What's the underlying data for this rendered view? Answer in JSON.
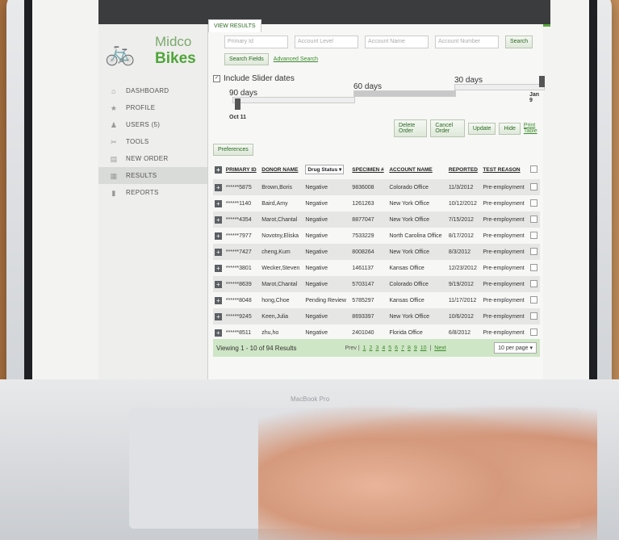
{
  "app": {
    "brand_top": "Midco",
    "brand_bottom": "Bikes"
  },
  "tabs": [
    {
      "label": "VIEW RESULTS"
    }
  ],
  "search": {
    "primary_id_placeholder": "Primary Id",
    "account_level_placeholder": "Account Level",
    "account_name_placeholder": "Account Name",
    "account_number_placeholder": "Account Number",
    "search_label": "Search",
    "search_fields_label": "Search Fields",
    "advanced_search_label": "Advanced Search"
  },
  "sidebar": {
    "items": [
      {
        "label": "DASHBOARD",
        "icon": "house-icon"
      },
      {
        "label": "PROFILE",
        "icon": "star-icon"
      },
      {
        "label": "USERS (5)",
        "icon": "users-icon"
      },
      {
        "label": "TOOLS",
        "icon": "tools-icon"
      },
      {
        "label": "NEW ORDER",
        "icon": "order-icon"
      },
      {
        "label": "RESULTS",
        "icon": "results-icon",
        "active": true
      },
      {
        "label": "REPORTS",
        "icon": "chart-icon"
      }
    ]
  },
  "slider": {
    "include_label": "Include Slider dates",
    "label_90": "90 days",
    "label_60": "60 days",
    "label_30": "30 days",
    "start_date": "Oct 11",
    "end_date": "Jan 9"
  },
  "actions": {
    "delete": "Delete Order",
    "cancel": "Cancel Order",
    "update": "Update",
    "hide": "Hide",
    "print": "Print Table",
    "preferences": "Preferences"
  },
  "table": {
    "headers": [
      "PRIMARY ID",
      "DONOR NAME",
      "Drug Status",
      "SPECIMEN #",
      "ACCOUNT NAME",
      "REPORTED",
      "TEST REASON"
    ],
    "rows": [
      [
        "******5875",
        "Brown,Boris",
        "Negative",
        "9836008",
        "Colorado Office",
        "11/3/2012",
        "Pre-employment"
      ],
      [
        "******1140",
        "Baird,Amy",
        "Negative",
        "1261263",
        "New York Office",
        "10/12/2012",
        "Pre-employment"
      ],
      [
        "******4354",
        "Marot,Chantal",
        "Negative",
        "8877047",
        "New York Office",
        "7/15/2012",
        "Pre-employment"
      ],
      [
        "******7977",
        "Novotny,Eliska",
        "Negative",
        "7533229",
        "North Carolina Office",
        "8/17/2012",
        "Pre-employment"
      ],
      [
        "******7427",
        "cheng,Kum",
        "Negative",
        "8008264",
        "New York Office",
        "8/3/2012",
        "Pre-employment"
      ],
      [
        "******3801",
        "Wecker,Steven",
        "Negative",
        "1461137",
        "Kansas Office",
        "12/23/2012",
        "Pre-employment"
      ],
      [
        "******8639",
        "Marot,Chantal",
        "Negative",
        "5703147",
        "Colorado Office",
        "9/19/2012",
        "Pre-employment"
      ],
      [
        "******8048",
        "hong,Choe",
        "Pending Review",
        "5785297",
        "Kansas Office",
        "11/17/2012",
        "Pre-employment"
      ],
      [
        "******9245",
        "Keen,Julia",
        "Negative",
        "8693397",
        "New York Office",
        "10/6/2012",
        "Pre-employment"
      ],
      [
        "******8511",
        "zhu,ho",
        "Negative",
        "2401040",
        "Florida Office",
        "6/8/2012",
        "Pre-employment"
      ]
    ]
  },
  "footer": {
    "viewing": "Viewing 1 - 10 of 94 Results",
    "prev": "Prev",
    "pages": [
      "1",
      "2",
      "3",
      "4",
      "5",
      "6",
      "7",
      "8",
      "9",
      "10"
    ],
    "next": "Next",
    "per_page": "10 per page"
  },
  "laptop": {
    "brand": "MacBook Pro"
  }
}
